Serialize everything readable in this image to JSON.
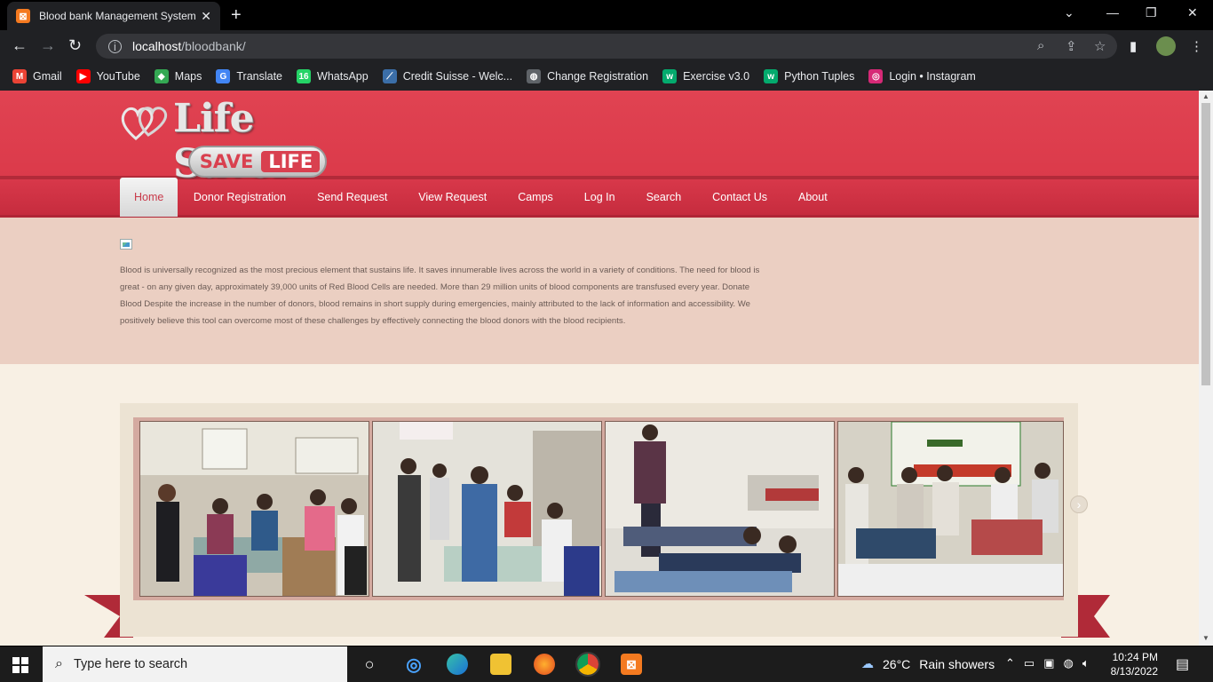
{
  "browser": {
    "tab_title": "Blood bank Management System",
    "tab_favicon": "XAMPP",
    "url_host": "localhost",
    "url_path": "/bloodbank/",
    "bookmarks": [
      {
        "label": "Gmail",
        "icon": "gmail-icon",
        "color": "#ea4335",
        "glyph": "M"
      },
      {
        "label": "YouTube",
        "icon": "youtube-icon",
        "color": "#ff0000",
        "glyph": "▶"
      },
      {
        "label": "Maps",
        "icon": "maps-icon",
        "color": "#34a853",
        "glyph": "◆"
      },
      {
        "label": "Translate",
        "icon": "translate-icon",
        "color": "#4285f4",
        "glyph": "G"
      },
      {
        "label": "WhatsApp",
        "icon": "whatsapp-icon",
        "color": "#25d366",
        "glyph": "16"
      },
      {
        "label": "Credit Suisse - Welc...",
        "icon": "credit-suisse-icon",
        "color": "#3b6ea8",
        "glyph": "⟋"
      },
      {
        "label": "Change Registration",
        "icon": "globe-icon",
        "color": "#5f6368",
        "glyph": "◍"
      },
      {
        "label": "Exercise v3.0",
        "icon": "w3schools-icon",
        "color": "#04aa6d",
        "glyph": "w"
      },
      {
        "label": "Python Tuples",
        "icon": "w3schools-icon",
        "color": "#04aa6d",
        "glyph": "w"
      },
      {
        "label": "Login • Instagram",
        "icon": "instagram-icon",
        "color": "#d62976",
        "glyph": "◎"
      }
    ]
  },
  "site": {
    "logo_text": "Life Saver",
    "logo_save": "SAVE",
    "logo_life": "LIFE",
    "nav": [
      {
        "label": "Home",
        "active": true
      },
      {
        "label": "Donor Registration",
        "active": false
      },
      {
        "label": "Send Request",
        "active": false
      },
      {
        "label": "View Request",
        "active": false
      },
      {
        "label": "Camps",
        "active": false
      },
      {
        "label": "Log In",
        "active": false
      },
      {
        "label": "Search",
        "active": false
      },
      {
        "label": "Contact Us",
        "active": false
      },
      {
        "label": "About",
        "active": false
      }
    ],
    "intro_text": "Blood is universally recognized as the most precious element that sustains life. It saves innumerable lives across the world in a variety of conditions. The need for blood is great - on any given day, approximately 39,000 units of Red Blood Cells are needed. More than 29 million units of blood components are transfused every year. Donate Blood Despite the increase in the number of donors, blood remains in short supply during emergencies, mainly attributed to the lack of information and accessibility. We positively believe this tool can overcome most of these challenges by effectively connecting the blood donors with the blood recipients.",
    "accent_color": "#dc3b4b"
  },
  "taskbar": {
    "search_placeholder": "Type here to search",
    "weather_temp": "26°C",
    "weather_desc": "Rain showers",
    "time": "10:24 PM",
    "date": "8/13/2022"
  }
}
